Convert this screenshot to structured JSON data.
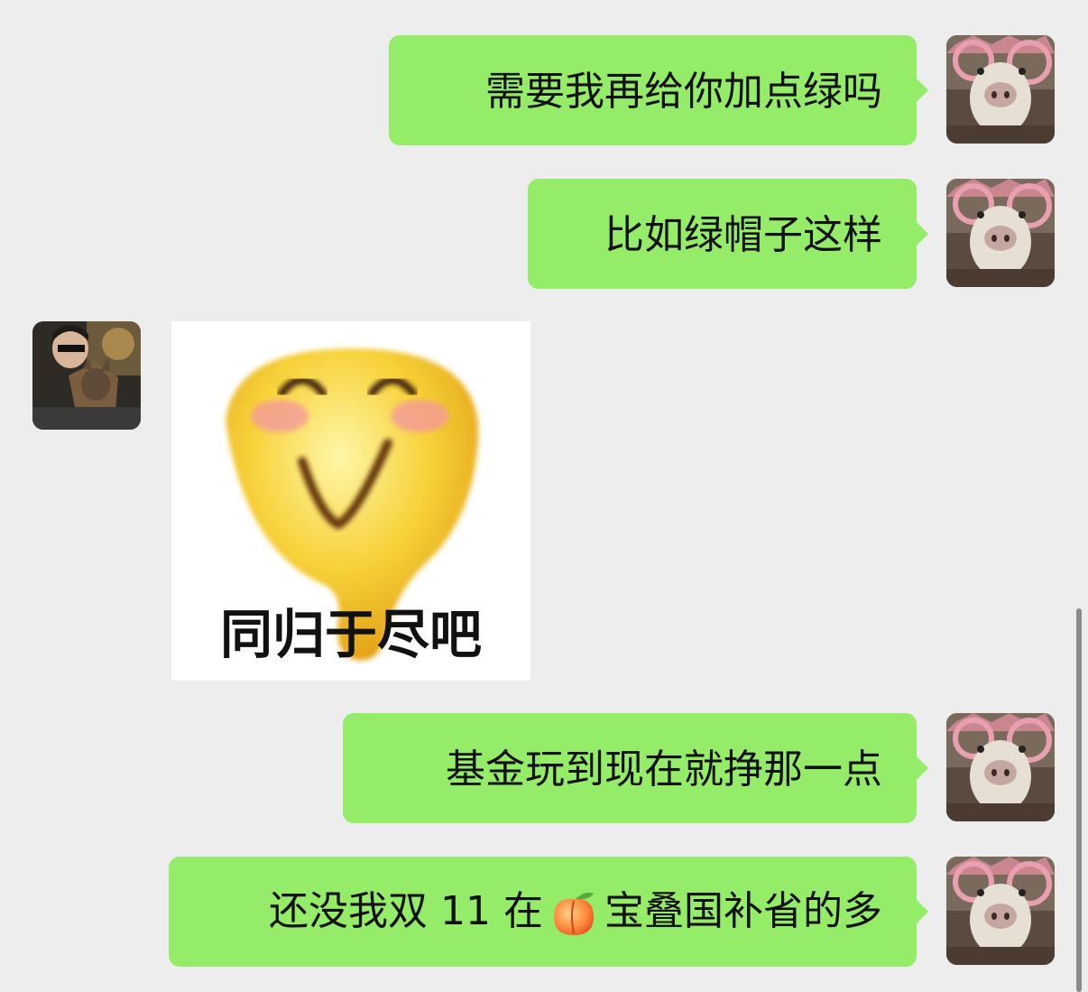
{
  "messages": [
    {
      "sender": "me",
      "text": "需要我再给你加点绿吗"
    },
    {
      "sender": "me",
      "text": "比如绿帽子这样"
    },
    {
      "sender": "other",
      "type": "sticker",
      "caption": "同归于尽吧",
      "icon": "smiling-blob-emoji"
    },
    {
      "sender": "me",
      "text": "基金玩到现在就挣那一点"
    },
    {
      "sender": "me",
      "text_before": "还没我双 11 在",
      "emoji": "peach-icon",
      "text_after": "宝叠国补省的多"
    }
  ],
  "colors": {
    "background": "#ededed",
    "my_bubble": "#95ec69",
    "sticker_bg": "#ffffff"
  },
  "avatars": {
    "me": "dog-with-pink-glasses-avatar",
    "other": "person-with-dog-in-car-avatar"
  }
}
